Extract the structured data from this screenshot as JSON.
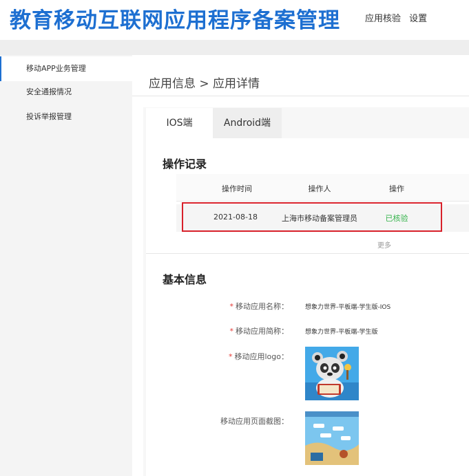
{
  "header": {
    "title": "教育移动互联网应用程序备案管理",
    "nav": [
      "应用核验",
      "设置"
    ]
  },
  "sidebar": {
    "items": [
      {
        "label": "移动APP业务管理",
        "active": true
      },
      {
        "label": "安全通报情况",
        "active": false
      },
      {
        "label": "投诉举报管理",
        "active": false
      }
    ]
  },
  "breadcrumb": "应用信息 > 应用详情",
  "tabs": [
    {
      "label": "IOS端",
      "active": true
    },
    {
      "label": "Android端",
      "active": false
    }
  ],
  "operation_log": {
    "title": "操作记录",
    "columns": [
      "操作时间",
      "操作人",
      "操作"
    ],
    "rows": [
      {
        "time": "2021-08-18",
        "operator": "上海市移动备案管理员",
        "action": "已核验"
      }
    ],
    "more": "更多"
  },
  "basic_info": {
    "title": "基本信息",
    "fields": {
      "app_name": {
        "label": "移动应用名称：",
        "value": "想象力世界-平板端-学生版-IOS",
        "required": true
      },
      "app_short_name": {
        "label": "移动应用简称：",
        "value": "想象力世界-平板端-学生版",
        "required": true
      },
      "app_logo": {
        "label": "移动应用logo：",
        "required": true
      },
      "app_screenshot": {
        "label": "移动应用页面截图：",
        "required": false
      }
    }
  },
  "colors": {
    "brand": "#1d6fd1",
    "status_ok": "#34b34a",
    "highlight": "#d8202a",
    "required": "#e53935"
  }
}
